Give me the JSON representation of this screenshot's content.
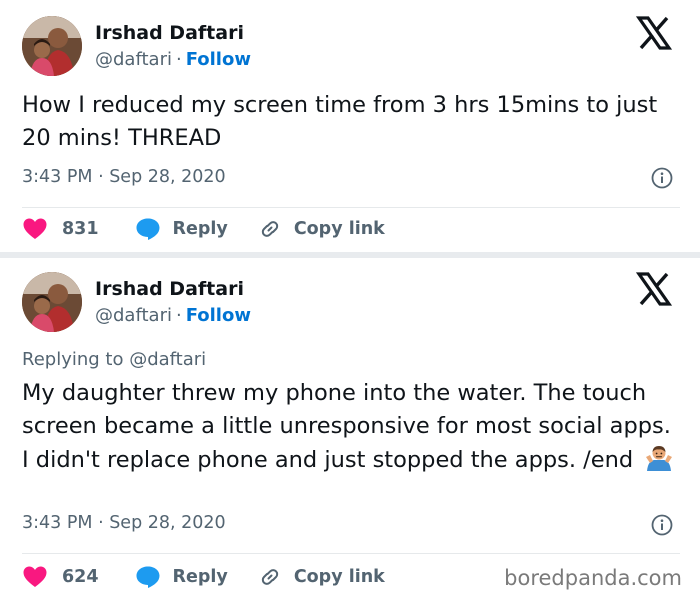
{
  "tweets": [
    {
      "author_name": "Irshad Daftari",
      "handle": "@daftari",
      "follow_label": "Follow",
      "separator": "·",
      "text": "How I reduced my screen time from 3 hrs 15mins to just 20 mins! THREAD",
      "time": "3:43 PM · Sep 28, 2020",
      "likes": "831",
      "reply_label": "Reply",
      "copy_link_label": "Copy link"
    },
    {
      "author_name": "Irshad Daftari",
      "handle": "@daftari",
      "follow_label": "Follow",
      "separator": "·",
      "replying_prefix": "Replying to ",
      "replying_to": "@daftari",
      "text": "My daughter threw my phone into the water. The touch screen became a little unresponsive for most social apps. I didn't replace phone and just stopped the apps. /end",
      "emoji": "person-shrugging",
      "time": "3:43 PM · Sep 28, 2020",
      "likes": "624",
      "reply_label": "Reply",
      "copy_link_label": "Copy link"
    }
  ],
  "watermark": "boredpanda.com",
  "icons": {
    "platform_logo": "x-logo-icon",
    "info": "info-icon",
    "like": "heart-icon",
    "reply": "reply-bubble-icon",
    "copy": "link-icon"
  },
  "colors": {
    "follow": "#0074d3",
    "heart": "#f91880",
    "reply_bubble": "#1d9bf0",
    "muted_text": "#536471",
    "separator": "#e8ebee"
  }
}
